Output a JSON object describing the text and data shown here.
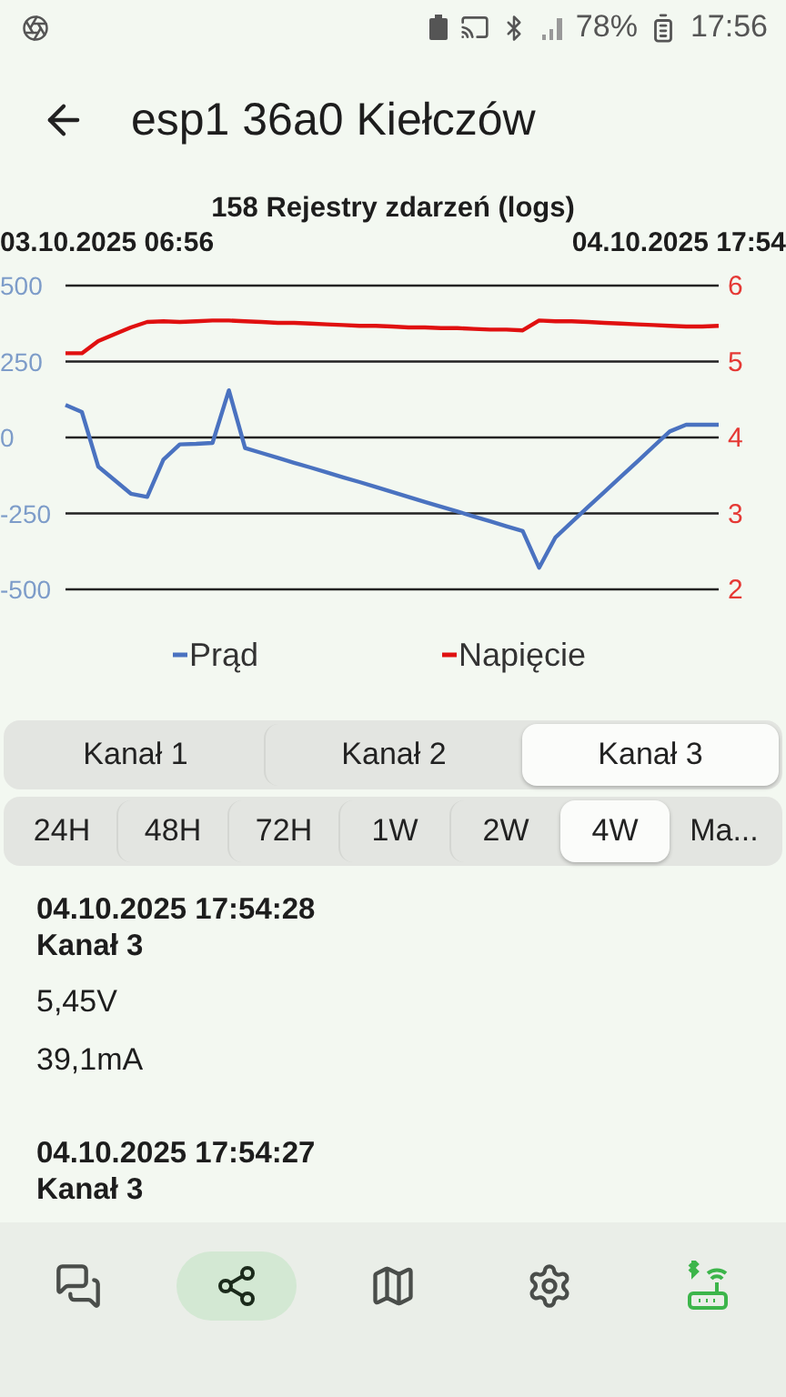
{
  "status_bar": {
    "battery": "78%",
    "time": "17:56"
  },
  "header": {
    "title": "esp1 36a0 Kiełczów"
  },
  "chart": {
    "title": "158 Rejestry zdarzeń (logs)",
    "start_label": "03.10.2025 06:56",
    "end_label": "04.10.2025 17:54",
    "chart_data": {
      "type": "line",
      "grid": true,
      "legend": "bottom",
      "ylim": [
        -500,
        500
      ],
      "yticks": [
        {
          "value": 500,
          "label": "500"
        },
        {
          "value": 250,
          "label": "250"
        },
        {
          "value": 0,
          "label": "0"
        },
        {
          "value": -250,
          "label": "-250"
        },
        {
          "value": -500,
          "label": "-500"
        }
      ],
      "y2lim": [
        2,
        6
      ],
      "y2ticks": [
        {
          "value": 6,
          "label": "6"
        },
        {
          "value": 5,
          "label": "5"
        },
        {
          "value": 4,
          "label": "4"
        },
        {
          "value": 3,
          "label": "3"
        },
        {
          "value": 2,
          "label": "2"
        }
      ],
      "categories": [
        null,
        null,
        null,
        null,
        null,
        null,
        null,
        null,
        null,
        null,
        null,
        null,
        null,
        null,
        null,
        null,
        null,
        null,
        null,
        null,
        null,
        null,
        null,
        null,
        null,
        null,
        null,
        null,
        null,
        null,
        null,
        null,
        null,
        null,
        null,
        null,
        null,
        null,
        null,
        null,
        null
      ],
      "series": [
        {
          "name": "Prąd",
          "color": "#4a72c0",
          "values": [
            107,
            84,
            -96,
            -140,
            -185,
            -196,
            -73,
            -23,
            -21,
            -18,
            155,
            -35,
            -51,
            -67,
            -83,
            -99,
            -115,
            -131,
            -147,
            -163,
            -179,
            -196,
            -212,
            -228,
            -244,
            -260,
            -276,
            -292,
            -308,
            -429,
            -329,
            -279,
            -229,
            -179,
            -130,
            -80,
            -30,
            20,
            42,
            42,
            42
          ]
        },
        {
          "name": "Napięcie",
          "color": "#e01010",
          "axis": "y2",
          "values": [
            5.11,
            5.11,
            5.27,
            5.36,
            5.45,
            5.52,
            5.53,
            5.52,
            5.53,
            5.54,
            5.54,
            5.53,
            5.52,
            5.51,
            5.51,
            5.5,
            5.49,
            5.48,
            5.47,
            5.47,
            5.46,
            5.45,
            5.45,
            5.44,
            5.44,
            5.43,
            5.42,
            5.42,
            5.41,
            5.54,
            5.53,
            5.53,
            5.52,
            5.51,
            5.5,
            5.49,
            5.48,
            5.47,
            5.46,
            5.46,
            5.47
          ]
        }
      ]
    }
  },
  "channel_tabs": [
    {
      "label": "Kanał 1",
      "selected": false
    },
    {
      "label": "Kanał 2",
      "selected": false
    },
    {
      "label": "Kanał 3",
      "selected": true
    }
  ],
  "period_tabs": [
    {
      "label": "24H",
      "selected": false
    },
    {
      "label": "48H",
      "selected": false
    },
    {
      "label": "72H",
      "selected": false
    },
    {
      "label": "1W",
      "selected": false
    },
    {
      "label": "2W",
      "selected": false
    },
    {
      "label": "4W",
      "selected": true
    },
    {
      "label": "Ma...",
      "selected": false
    }
  ],
  "logs": [
    {
      "timestamp": "04.10.2025 17:54:28",
      "channel": "Kanał 3",
      "voltage": "5,45V",
      "current": "39,1mA"
    },
    {
      "timestamp": "04.10.2025 17:54:27",
      "channel": "Kanał 3"
    }
  ],
  "nav": [
    {
      "kind": "chat",
      "selected": false
    },
    {
      "kind": "graph",
      "selected": true
    },
    {
      "kind": "map",
      "selected": false
    },
    {
      "kind": "settings",
      "selected": false
    },
    {
      "kind": "router",
      "selected": false
    }
  ]
}
